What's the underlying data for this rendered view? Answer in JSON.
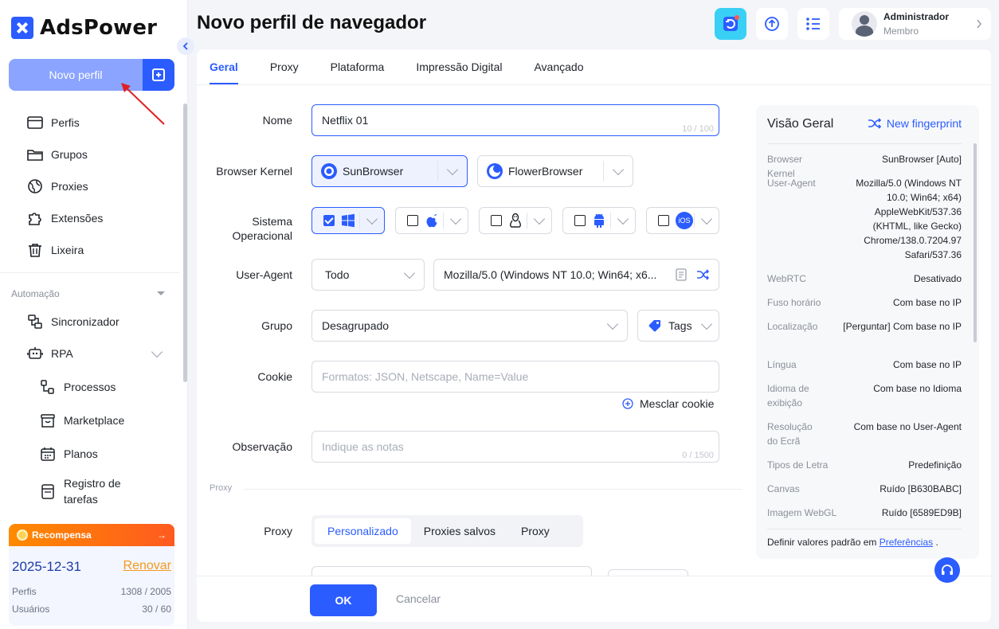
{
  "app": {
    "logo_text": "AdsPower"
  },
  "sidebar": {
    "new_profile_label": "Novo perfil",
    "items": [
      {
        "label": "Perfis",
        "icon": "browser-window-icon"
      },
      {
        "label": "Grupos",
        "icon": "folder-icon"
      },
      {
        "label": "Proxies",
        "icon": "globe-icon"
      },
      {
        "label": "Extensões",
        "icon": "puzzle-icon"
      },
      {
        "label": "Lixeira",
        "icon": "trash-icon"
      }
    ],
    "automation_label": "Automação",
    "automation_items": [
      {
        "label": "Sincronizador",
        "icon": "sync-icon"
      },
      {
        "label": "RPA",
        "icon": "robot-icon"
      }
    ],
    "rpa_items": [
      {
        "label": "Processos",
        "icon": "flow-icon"
      },
      {
        "label": "Marketplace",
        "icon": "basket-icon"
      },
      {
        "label": "Planos",
        "icon": "calendar-icon"
      },
      {
        "label": "Registro de tarefas",
        "icon": "clipboard-icon"
      }
    ],
    "reward": {
      "title": "Recompensa",
      "arrow": "→",
      "date": "2025-12-31",
      "renew": "Renovar",
      "profiles_label": "Perfis",
      "profiles_value": "1308 / 2005",
      "users_label": "Usuários",
      "users_value": "30 / 60"
    }
  },
  "header": {
    "title": "Novo perfil de navegador",
    "user_name": "Administrador",
    "user_role": "Membro"
  },
  "tabs": [
    "Geral",
    "Proxy",
    "Plataforma",
    "Impressão Digital",
    "Avançado"
  ],
  "form": {
    "name_label": "Nome",
    "name_value": "Netflix 01",
    "name_counter": "10 / 100",
    "kernel_label": "Browser Kernel",
    "kernel_options": [
      "SunBrowser",
      "FlowerBrowser"
    ],
    "os_label": "Sistema Operacional",
    "os_ios": "iOS",
    "ua_label": "User-Agent",
    "ua_select": "Todo",
    "ua_value": "Mozilla/5.0 (Windows NT 10.0; Win64; x6...",
    "group_label": "Grupo",
    "group_value": "Desagrupado",
    "tags_label": "Tags",
    "cookie_label": "Cookie",
    "cookie_placeholder": "Formatos: JSON, Netscape, Name=Value",
    "merge_cookie": "Mesclar cookie",
    "notes_label": "Observação",
    "notes_placeholder": "Indique as notas",
    "notes_counter": "0 / 1500",
    "proxy_section": "Proxy",
    "proxy_label": "Proxy",
    "proxy_options": [
      "Personalizado",
      "Proxies salvos",
      "Proxy"
    ]
  },
  "footer": {
    "ok": "OK",
    "cancel": "Cancelar"
  },
  "overview": {
    "title": "Visão Geral",
    "new_fingerprint": "New fingerprint",
    "rows": [
      {
        "k": "Browser Kernel",
        "v": "SunBrowser [Auto]"
      },
      {
        "k": "User-Agent",
        "v": "Mozilla/5.0 (Windows NT 10.0; Win64; x64) AppleWebKit/537.36 (KHTML, like Gecko) Chrome/138.0.7204.97 Safari/537.36"
      },
      {
        "k": "WebRTC",
        "v": "Desativado"
      },
      {
        "k": "Fuso horário",
        "v": "Com base no IP"
      },
      {
        "k": "Localização",
        "v": "[Perguntar] Com base no IP"
      },
      {
        "k": "Língua",
        "v": "Com base no IP"
      },
      {
        "k": "Idioma de exibição",
        "v": "Com base no Idioma"
      },
      {
        "k": "Resolução do Ecrã",
        "v": "Com base no User-Agent"
      },
      {
        "k": "Tipos de Letra",
        "v": "Predefinição"
      },
      {
        "k": "Canvas",
        "v": "Ruído [B630BABC]"
      },
      {
        "k": "Imagem WebGL",
        "v": "Ruído [6589ED9B]"
      }
    ],
    "pref_text": "Definir valores padrão em",
    "pref_link": "Preferências",
    "pref_end": "."
  },
  "colors": {
    "accent": "#2b5cff",
    "reward": "#ff6a14"
  }
}
